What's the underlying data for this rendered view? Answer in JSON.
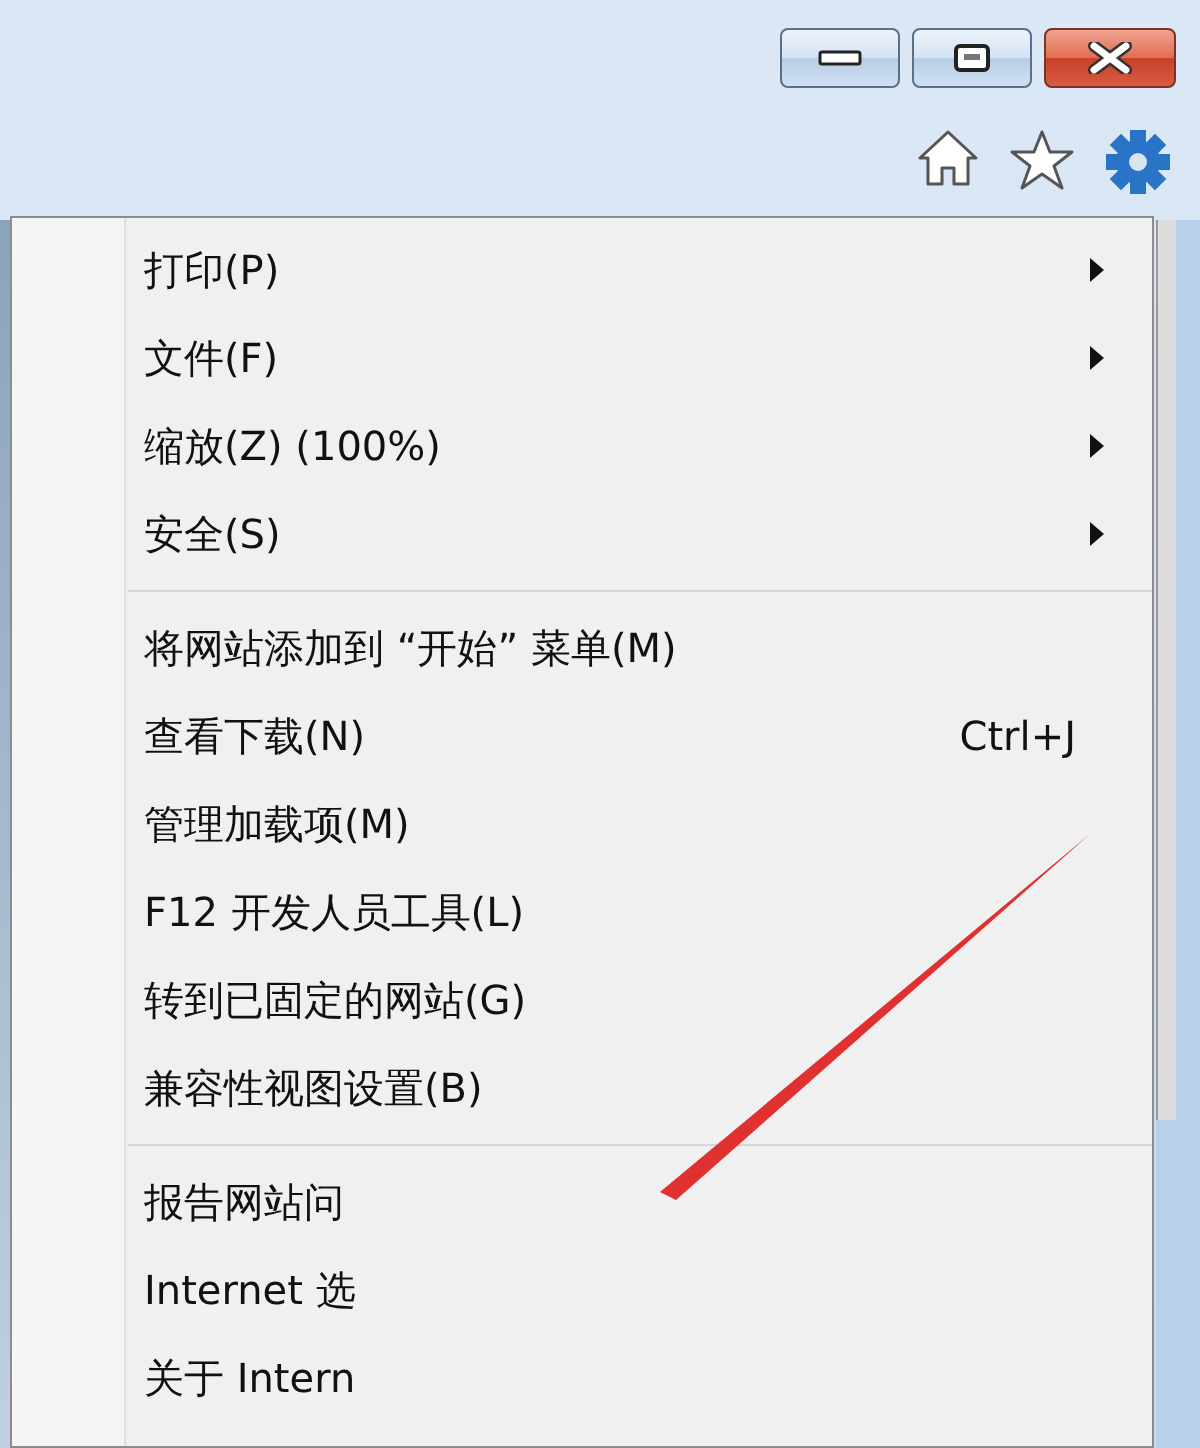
{
  "menu": {
    "sections": [
      {
        "items": [
          {
            "label": "打印(P)",
            "submenu": true
          },
          {
            "label": "文件(F)",
            "submenu": true
          },
          {
            "label": "缩放(Z) (100%)",
            "submenu": true
          },
          {
            "label": "安全(S)",
            "submenu": true
          }
        ]
      },
      {
        "items": [
          {
            "label": "将网站添加到 “开始” 菜单(M)",
            "submenu": false
          },
          {
            "label": "查看下载(N)",
            "shortcut": "Ctrl+J",
            "submenu": false
          },
          {
            "label": "管理加载项(M)",
            "submenu": false
          },
          {
            "label": "F12 开发人员工具(L)",
            "submenu": false
          },
          {
            "label": "转到已固定的网站(G)",
            "submenu": false
          },
          {
            "label": "兼容性视图设置(B)",
            "submenu": false
          }
        ]
      },
      {
        "items": [
          {
            "label": "报告网站问",
            "submenu": false
          },
          {
            "label": "Internet 选",
            "submenu": false
          },
          {
            "label": "关于 Intern",
            "submenu": false
          }
        ]
      }
    ]
  }
}
